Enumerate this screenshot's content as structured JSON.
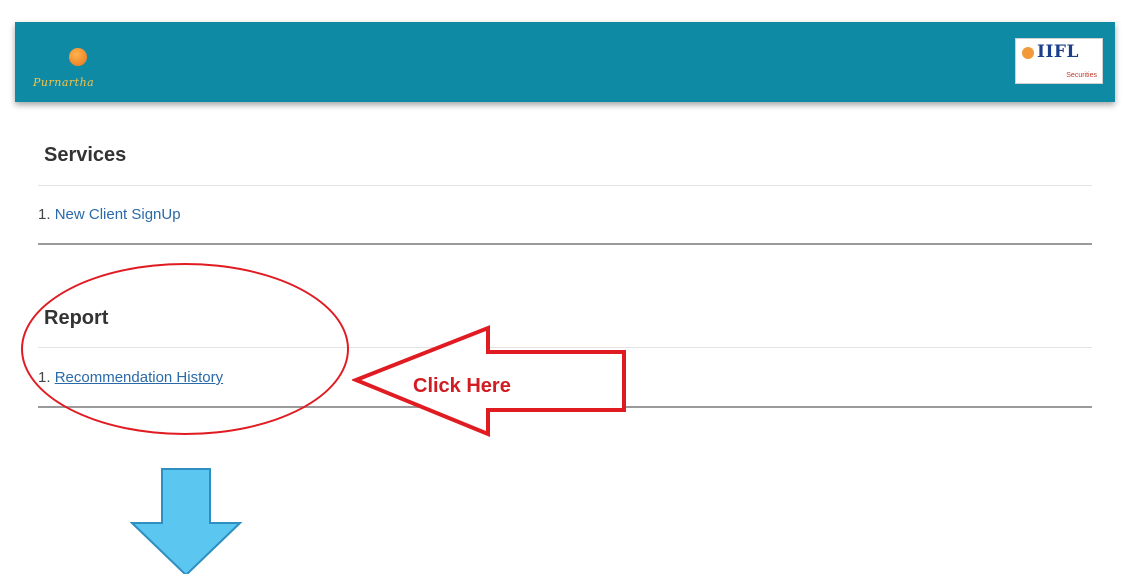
{
  "header": {
    "brand_text": "Purnartha",
    "partner_logo_text": "IIFL",
    "partner_logo_subtext": "Securities",
    "background_color": "#0f8aa5"
  },
  "services": {
    "title": "Services",
    "items": [
      {
        "number": "1.",
        "label": "New Client SignUp"
      }
    ]
  },
  "report": {
    "title": "Report",
    "items": [
      {
        "number": "1.",
        "label": "Recommendation History"
      }
    ]
  },
  "annotation": {
    "callout_text": "Click Here",
    "callout_color": "#e01b22",
    "down_arrow_color": "#5bc6ef"
  }
}
